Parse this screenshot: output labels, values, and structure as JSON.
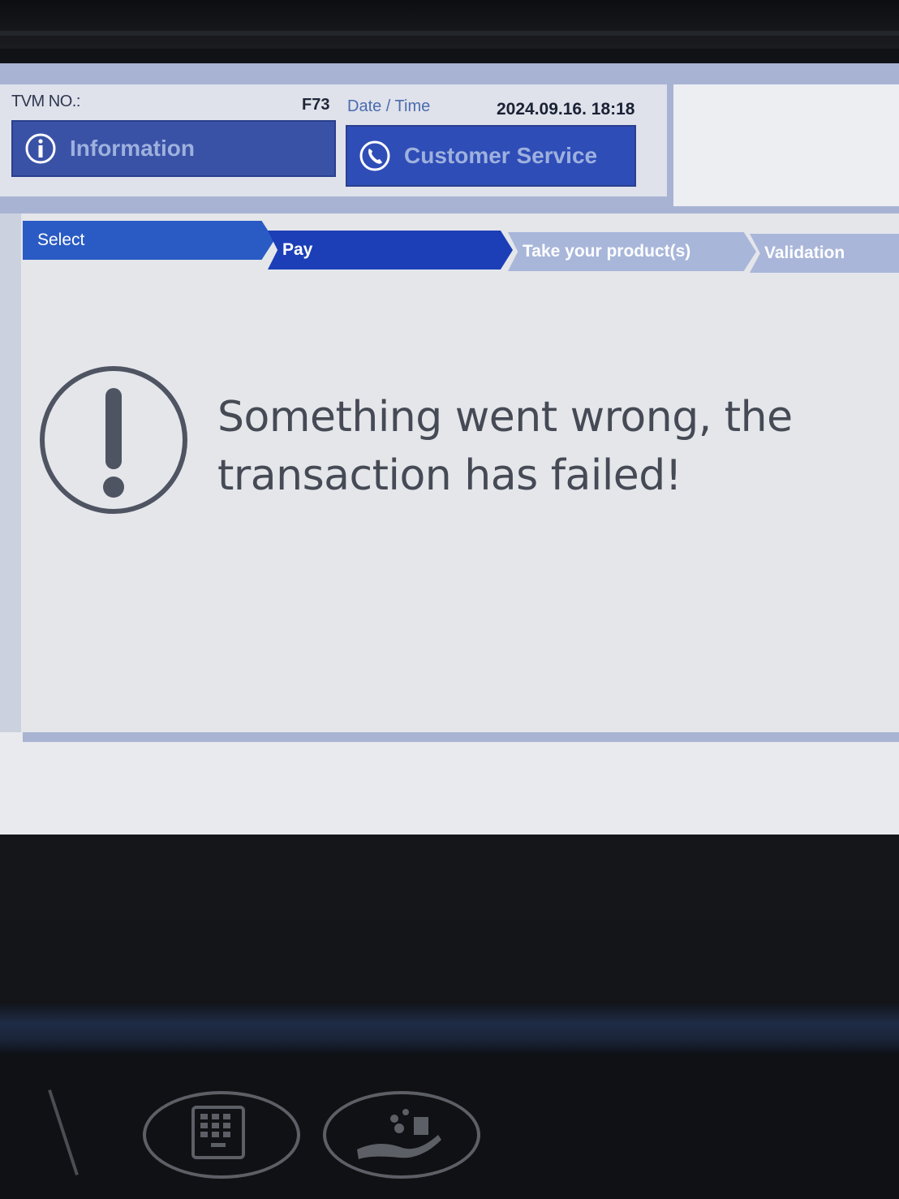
{
  "header": {
    "tvm_label": "TVM NO.:",
    "tvm_value": "F73",
    "datetime_label": "Date / Time",
    "datetime_value": "2024.09.16. 18:18",
    "info_button_label": "Information",
    "info_icon": "info-icon",
    "cs_button_label": "Customer Service",
    "cs_icon": "phone-icon"
  },
  "steps": [
    {
      "label": "Select",
      "state": "done"
    },
    {
      "label": "Pay",
      "state": "active"
    },
    {
      "label": "Take your product(s)",
      "state": "pending"
    },
    {
      "label": "Validation",
      "state": "pending"
    }
  ],
  "message": {
    "icon": "alert-icon",
    "line1": "Something went wrong, the",
    "line2": "transaction has failed!"
  },
  "hardware": {
    "left_button_icon": "keypad-icon",
    "right_button_icon": "coin-payment-icon"
  },
  "colors": {
    "accent": "#1c3fb8",
    "header_bar": "#a8b3d4",
    "screen_bg": "#e4e6ea"
  }
}
